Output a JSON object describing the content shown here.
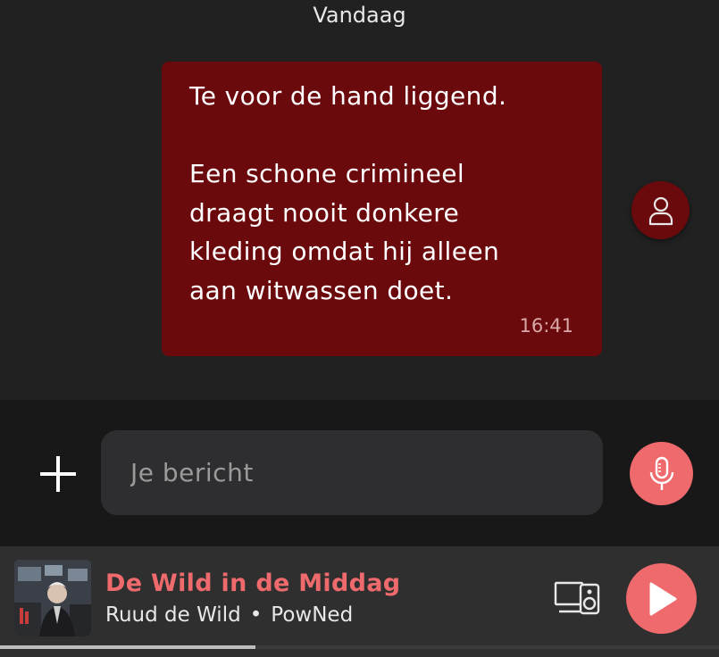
{
  "chat": {
    "day_label": "Vandaag",
    "message": {
      "text": "Te voor de hand liggend.\n\nEen schone crimineel\ndraagt nooit donkere\nkleding omdat hij alleen\naan witwassen doet.",
      "time": "16:41",
      "sender_icon": "person-icon"
    }
  },
  "composer": {
    "add_icon": "plus-icon",
    "placeholder": "Je bericht",
    "value": "",
    "mic_icon": "microphone-icon"
  },
  "player": {
    "title": "De Wild in de Middag",
    "host": "Ruud de Wild",
    "separator": "•",
    "station": "PowNed",
    "cast_icon": "cast-devices-icon",
    "play_icon": "play-icon",
    "progress": 0.355
  },
  "colors": {
    "background": "#212121",
    "bubble": "#6b0a0d",
    "accent": "#ee6a6c",
    "composer_bg": "#181818",
    "player_bg": "#2f2f2f"
  }
}
